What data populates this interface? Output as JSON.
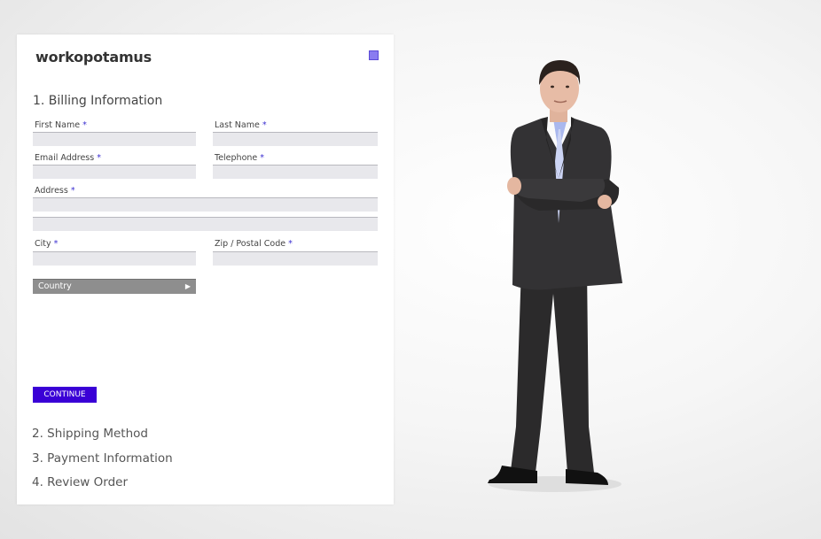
{
  "brand": "workopotamus",
  "form": {
    "step_title": "1. Billing Information",
    "required_marker": "*",
    "first_name_label": "First Name",
    "last_name_label": "Last Name",
    "email_label": "Email Address",
    "telephone_label": "Telephone",
    "address_label": "Address",
    "city_label": "City",
    "zip_label": "Zip / Postal Code",
    "country_select": "Country",
    "continue_label": "CONTINUE"
  },
  "steps": [
    "2. Shipping Method",
    "3. Payment Information",
    "4. Review Order"
  ],
  "colors": {
    "accent": "#3a00d6",
    "field_bg": "#e8e8ec",
    "select_bg": "#8e8e8e"
  }
}
